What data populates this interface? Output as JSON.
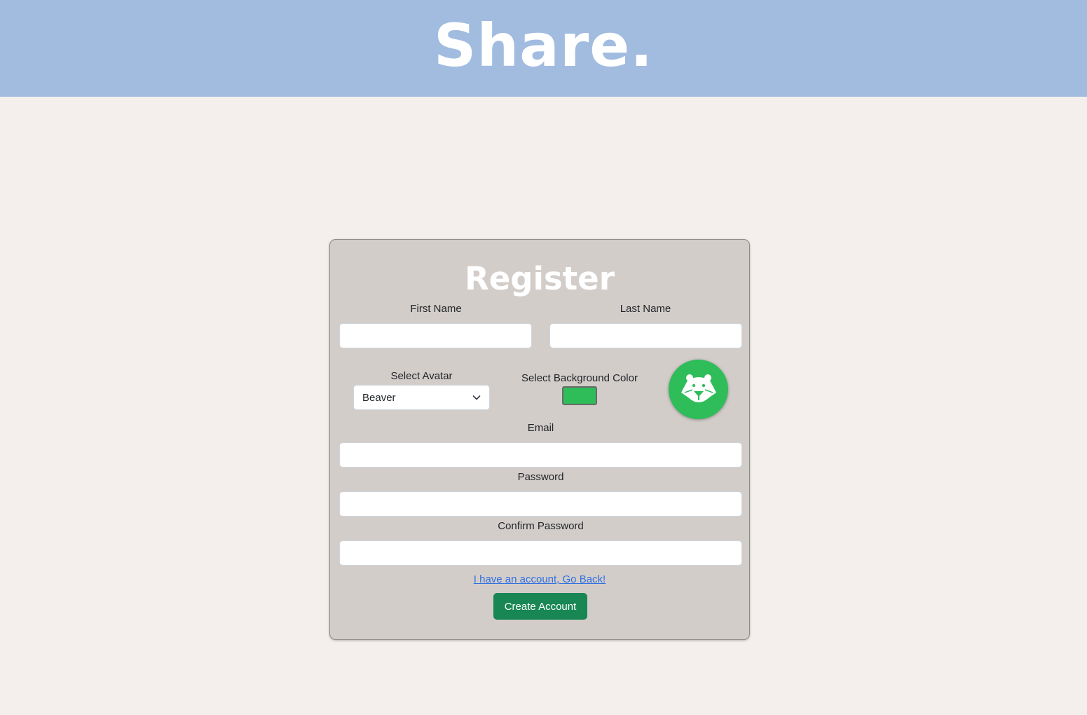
{
  "header": {
    "brand": "Share."
  },
  "form": {
    "title": "Register",
    "first_name_label": "First Name",
    "first_name_value": "",
    "last_name_label": "Last Name",
    "last_name_value": "",
    "avatar_label": "Select Avatar",
    "avatar_value": "Beaver",
    "avatar_icon": "beaver-icon",
    "bg_color_label": "Select Background Color",
    "bg_color_value": "#2ebd59",
    "email_label": "Email",
    "email_value": "",
    "password_label": "Password",
    "password_value": "",
    "confirm_password_label": "Confirm Password",
    "confirm_password_value": "",
    "back_link": "I have an account, Go Back!",
    "submit_label": "Create Account"
  },
  "colors": {
    "header_bg": "#a2bce0",
    "page_bg": "#f4efec",
    "card_bg": "#d3cdca",
    "button_bg": "#198754",
    "link": "#2f6fe0"
  }
}
